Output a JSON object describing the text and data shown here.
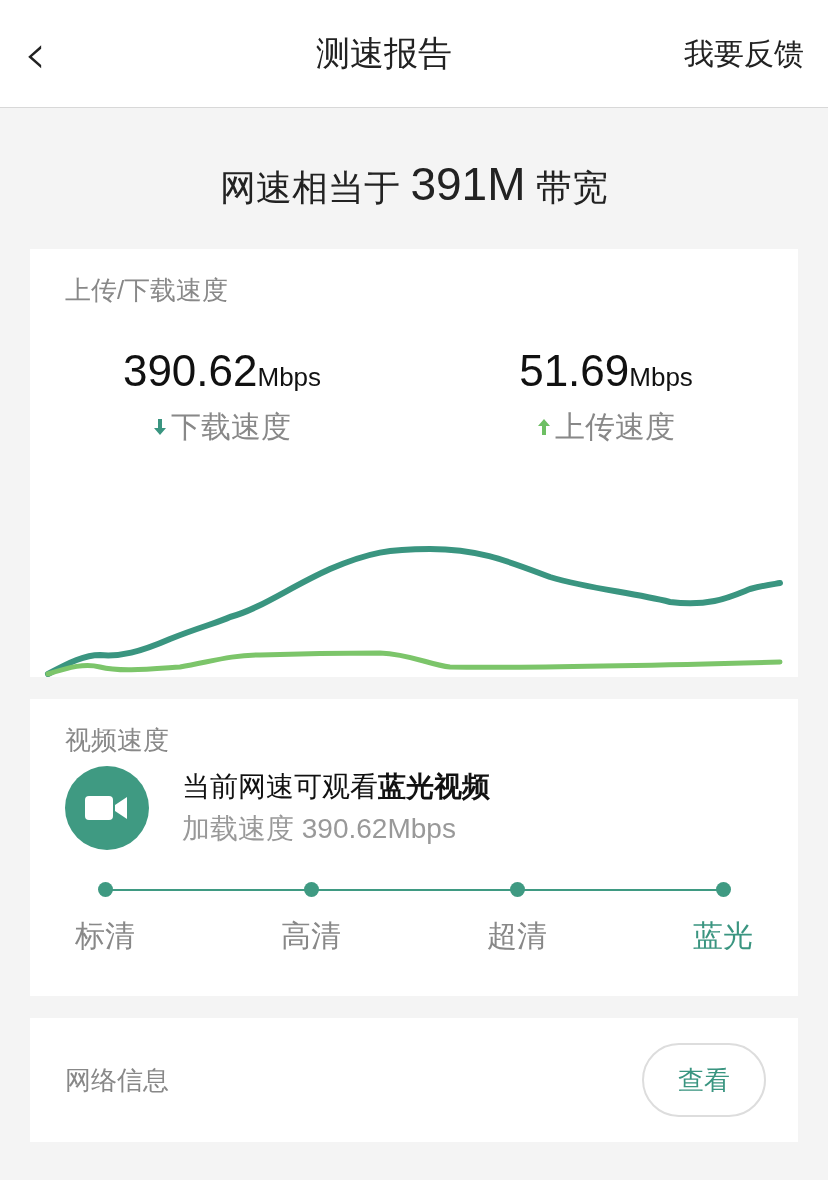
{
  "header": {
    "back": "‹",
    "title": "测速报告",
    "action": "我要反馈"
  },
  "summary": {
    "prefix": "网速相当于",
    "value": "391M",
    "suffix": "带宽"
  },
  "speed_card": {
    "title": "上传/下载速度",
    "stats": [
      {
        "kind": "download",
        "value": "390.62",
        "unit": "Mbps",
        "label": "下载速度"
      },
      {
        "kind": "upload",
        "value": "51.69",
        "unit": "Mbps",
        "label": "上传速度"
      }
    ]
  },
  "video_card": {
    "title": "视频速度",
    "headline": "当前网速可观看**蓝光视频**",
    "detail": "加载速度 390.62Mbps",
    "levels": [
      {
        "label": "标清",
        "selected": false
      },
      {
        "label": "高清",
        "selected": false
      },
      {
        "label": "超清",
        "selected": false
      },
      {
        "label": "蓝光",
        "selected": true
      }
    ]
  },
  "network_card": {
    "title": "网络信息",
    "button": "查看"
  }
}
